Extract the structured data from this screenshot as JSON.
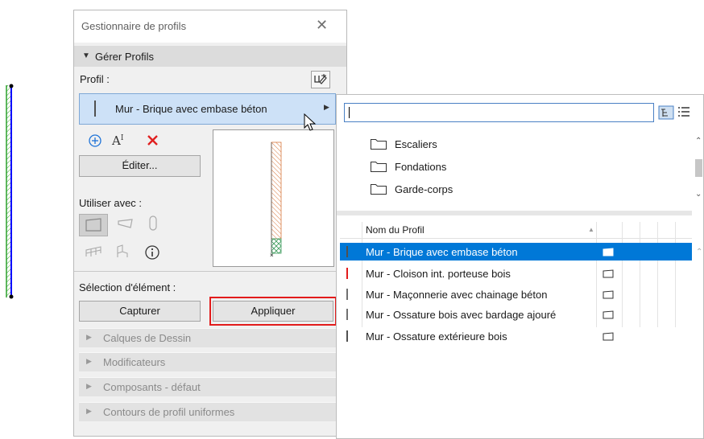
{
  "colors": {
    "accent": "#0078d7",
    "selected_row": "#0078d7",
    "apply_highlight": "#e21b1b",
    "wall_stroke": "#0000ff",
    "wall_hatch": "#2aa02a",
    "cursor": "#ffffff"
  },
  "palette": {
    "title": "Gestionnaire de profils",
    "section_label": "Gérer Profils",
    "profile_label": "Profil :",
    "current_profile": "Mur - Brique avec embase béton",
    "edit_label": "Éditer...",
    "use_with_label": "Utiliser avec :",
    "selection_label": "Sélection d'élément :",
    "capture_label": "Capturer",
    "apply_label": "Appliquer",
    "collapsed_sections": [
      "Calques de Dessin",
      "Modificateurs",
      "Composants - défaut",
      "Contours de profil uniformes"
    ]
  },
  "flyout": {
    "search_value": "",
    "folders": [
      "Escaliers",
      "Fondations",
      "Garde-corps"
    ],
    "column_header": "Nom du Profil",
    "rows": [
      {
        "name": "Mur - Brique avec embase béton",
        "bar_color": "#505050",
        "selected": true
      },
      {
        "name": "Mur - Cloison int. porteuse bois",
        "bar_color": "#e21b1b",
        "selected": false
      },
      {
        "name": "Mur - Maçonnerie avec chainage béton",
        "bar_color": "#707070",
        "selected": false
      },
      {
        "name": "Mur - Ossature bois avec bardage ajouré",
        "bar_color": "#707070",
        "selected": false
      },
      {
        "name": "Mur - Ossature extérieure bois",
        "bar_color": "#505050",
        "selected": false
      }
    ]
  }
}
